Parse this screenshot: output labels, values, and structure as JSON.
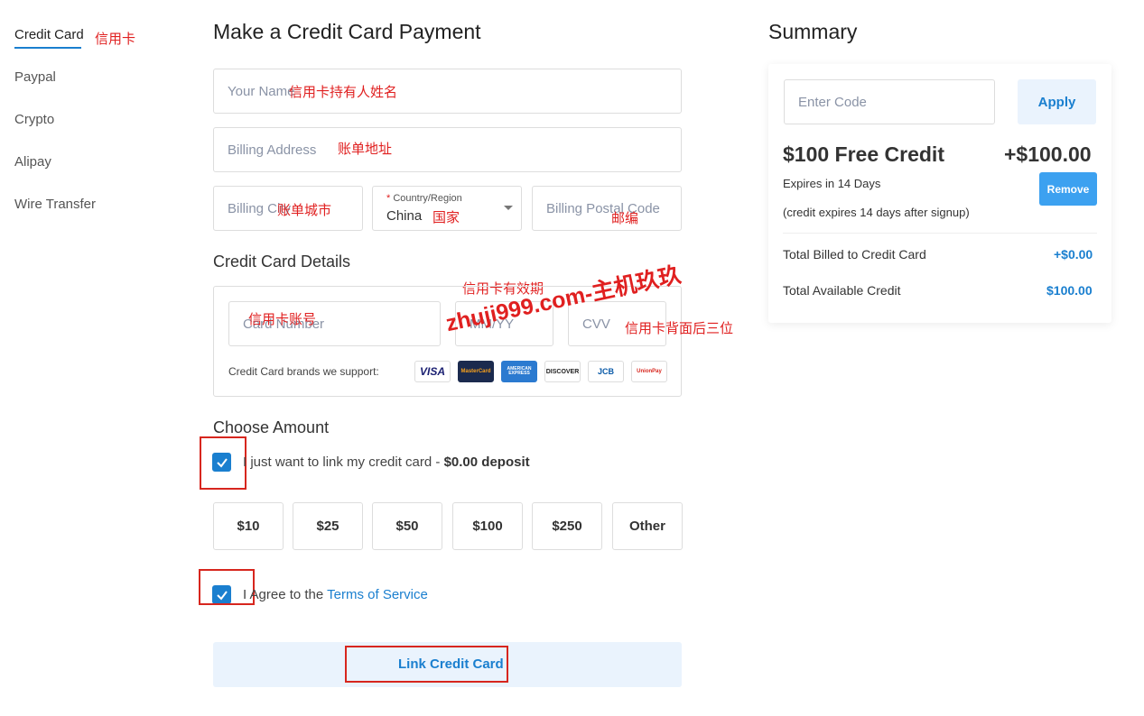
{
  "nav": {
    "items": [
      {
        "label": "Credit Card"
      },
      {
        "label": "Paypal"
      },
      {
        "label": "Crypto"
      },
      {
        "label": "Alipay"
      },
      {
        "label": "Wire Transfer"
      }
    ],
    "active_annotation": "信用卡"
  },
  "form": {
    "title": "Make a Credit Card Payment",
    "name_placeholder": "Your Name",
    "name_annotation": "信用卡持有人姓名",
    "address_placeholder": "Billing Address",
    "address_annotation": "账单地址",
    "city_placeholder": "Billing City",
    "city_annotation": "账单城市",
    "country_label": "Country/Region",
    "country_required": "*",
    "country_value": "China",
    "country_annotation": "国家",
    "postal_placeholder": "Billing Postal Code",
    "postal_annotation": "邮编",
    "card_section_title": "Credit Card Details",
    "expiry_annotation": "信用卡有效期",
    "card_number_placeholder": "Card Number",
    "card_number_annotation": "信用卡账号",
    "expiry_placeholder": "MM/YY",
    "cvv_placeholder": "CVV",
    "cvv_annotation": "信用卡背面后三位",
    "brands_label": "Credit Card brands we support:",
    "brands": [
      "VISA",
      "MasterCard",
      "AMERICAN EXPRESS",
      "DISCOVER",
      "JCB",
      "UnionPay"
    ],
    "amount_title": "Choose Amount",
    "link_only_text": "I just want to link my credit card - ",
    "link_only_bold": "$0.00 deposit",
    "amounts": [
      "$10",
      "$25",
      "$50",
      "$100",
      "$250",
      "Other"
    ],
    "agree_text": "I Agree to the ",
    "terms_link": "Terms of Service",
    "submit_label": "Link Credit Card"
  },
  "watermark": "zhuji999.com-主机玖玖",
  "summary": {
    "title": "Summary",
    "code_placeholder": "Enter Code",
    "apply_label": "Apply",
    "credit_title": "$100 Free Credit",
    "credit_amount": "+$100.00",
    "expires": "Expires in 14 Days",
    "remove_label": "Remove",
    "note": "(credit expires 14 days after signup)",
    "billed_label": "Total Billed to Credit Card",
    "billed_value": "+$0.00",
    "available_label": "Total Available Credit",
    "available_value": "$100.00"
  },
  "colors": {
    "accent": "#1a7fcf",
    "annotation": "#e02020",
    "remove_button": "#3ca1f0"
  }
}
